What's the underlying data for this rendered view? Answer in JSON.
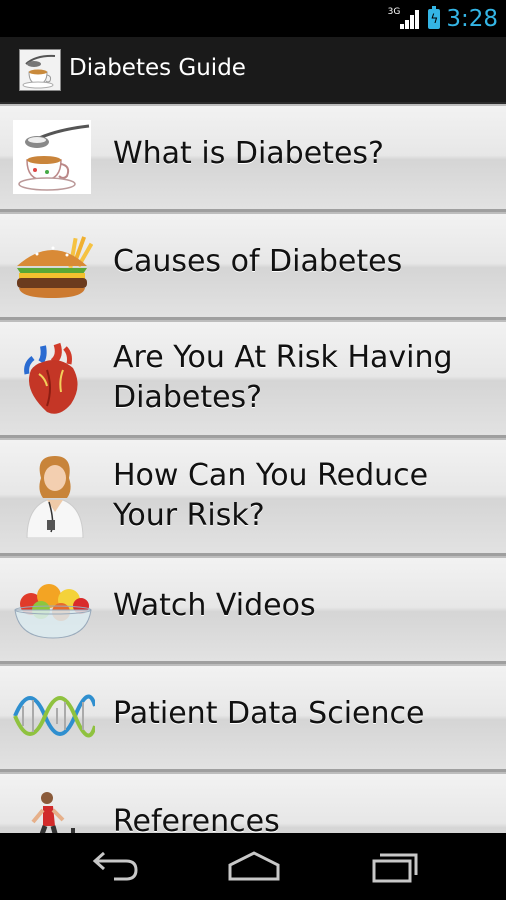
{
  "status_bar": {
    "network": "3G",
    "time": "3:28",
    "accent_color": "#34b5e5"
  },
  "action_bar": {
    "title": "Diabetes Guide",
    "icon": "teacup-sugar-icon"
  },
  "menu": {
    "items": [
      {
        "label": "What is Diabetes?",
        "icon": "teacup-sugar-icon"
      },
      {
        "label": "Causes of Diabetes",
        "icon": "burger-fries-icon"
      },
      {
        "label": "Are You At Risk Having Diabetes?",
        "icon": "heart-icon"
      },
      {
        "label": "How Can You Reduce Your Risk?",
        "icon": "doctor-icon"
      },
      {
        "label": "Watch Videos",
        "icon": "fruit-bowl-icon"
      },
      {
        "label": "Patient Data Science",
        "icon": "dna-icon"
      },
      {
        "label": "References",
        "icon": "treadmill-icon"
      }
    ]
  },
  "nav_bar": {
    "back": "back-icon",
    "home": "home-icon",
    "recents": "recent-apps-icon"
  }
}
